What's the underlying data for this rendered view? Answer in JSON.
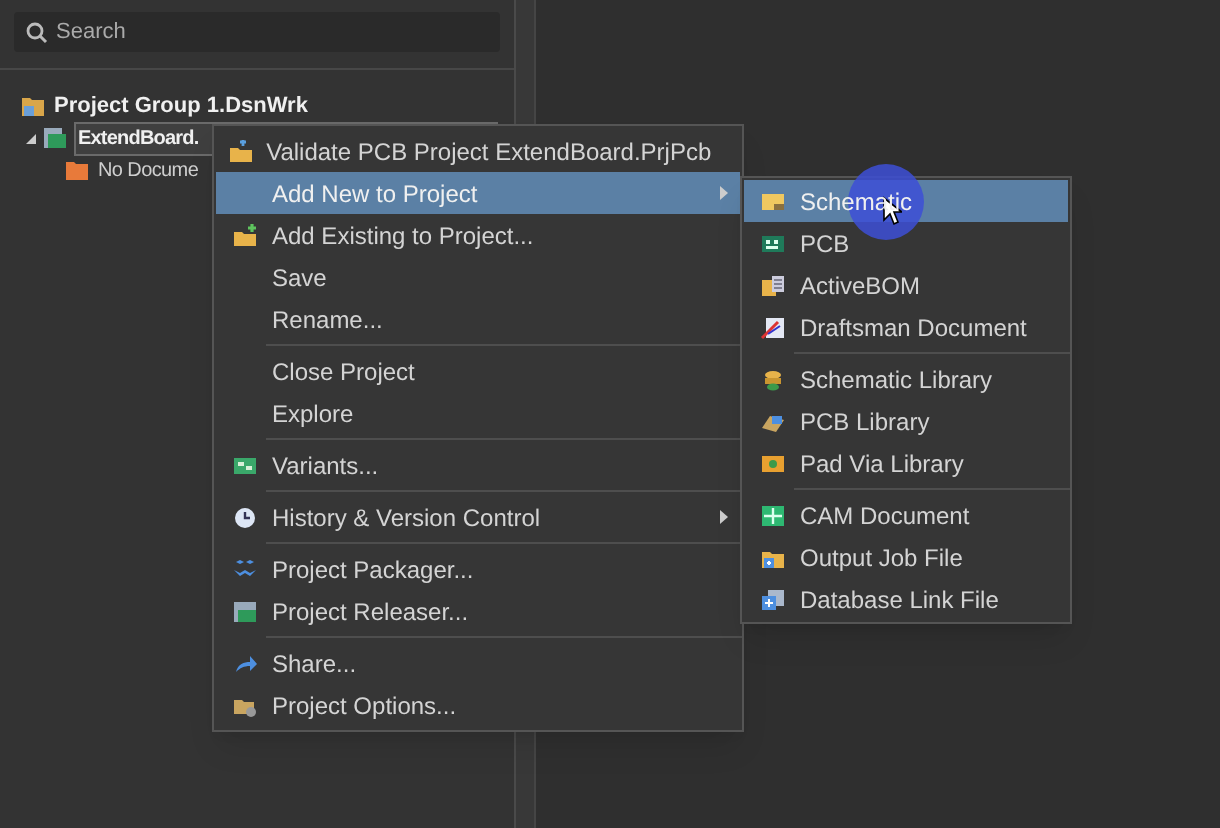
{
  "search": {
    "placeholder": "Search"
  },
  "tree": [
    {
      "label": "Project Group 1.DsnWrk",
      "children": [
        {
          "label": "ExtendBoard.",
          "selected": true,
          "expanded": true,
          "children": [
            {
              "label": "No Docume"
            }
          ]
        }
      ]
    }
  ],
  "context_menu": [
    {
      "label": "Validate PCB Project ExtendBoard.PrjPcb",
      "separator_before": false,
      "submenu": false,
      "selected": false
    },
    {
      "label": "Add New to Project",
      "separator_before": false,
      "submenu": true,
      "selected": true
    },
    {
      "label": "Add Existing to Project...",
      "separator_before": false,
      "submenu": false,
      "selected": false
    },
    {
      "label": "Save",
      "separator_before": false,
      "submenu": false,
      "selected": false
    },
    {
      "label": "Rename...",
      "separator_before": false,
      "submenu": false,
      "selected": false
    },
    {
      "label": "Close Project",
      "separator_before": true,
      "submenu": false,
      "selected": false
    },
    {
      "label": "Explore",
      "separator_before": false,
      "submenu": false,
      "selected": false
    },
    {
      "label": "Variants...",
      "separator_before": true,
      "submenu": false,
      "selected": false
    },
    {
      "label": "History & Version Control",
      "separator_before": true,
      "submenu": true,
      "selected": false
    },
    {
      "label": "Project Packager...",
      "separator_before": true,
      "submenu": false,
      "selected": false
    },
    {
      "label": "Project Releaser...",
      "separator_before": false,
      "submenu": false,
      "selected": false
    },
    {
      "label": "Share...",
      "separator_before": true,
      "submenu": false,
      "selected": false
    },
    {
      "label": "Project Options...",
      "separator_before": false,
      "submenu": false,
      "selected": false
    }
  ],
  "submenu": [
    {
      "label": "Schematic",
      "separator_before": false,
      "selected": true
    },
    {
      "label": "PCB",
      "separator_before": false,
      "selected": false
    },
    {
      "label": "ActiveBOM",
      "separator_before": false,
      "selected": false
    },
    {
      "label": "Draftsman Document",
      "separator_before": false,
      "selected": false
    },
    {
      "label": "Schematic Library",
      "separator_before": true,
      "selected": false
    },
    {
      "label": "PCB Library",
      "separator_before": false,
      "selected": false
    },
    {
      "label": "Pad Via Library",
      "separator_before": false,
      "selected": false
    },
    {
      "label": "CAM Document",
      "separator_before": true,
      "selected": false
    },
    {
      "label": "Output Job File",
      "separator_before": false,
      "selected": false
    },
    {
      "label": "Database Link File",
      "separator_before": false,
      "selected": false
    }
  ]
}
